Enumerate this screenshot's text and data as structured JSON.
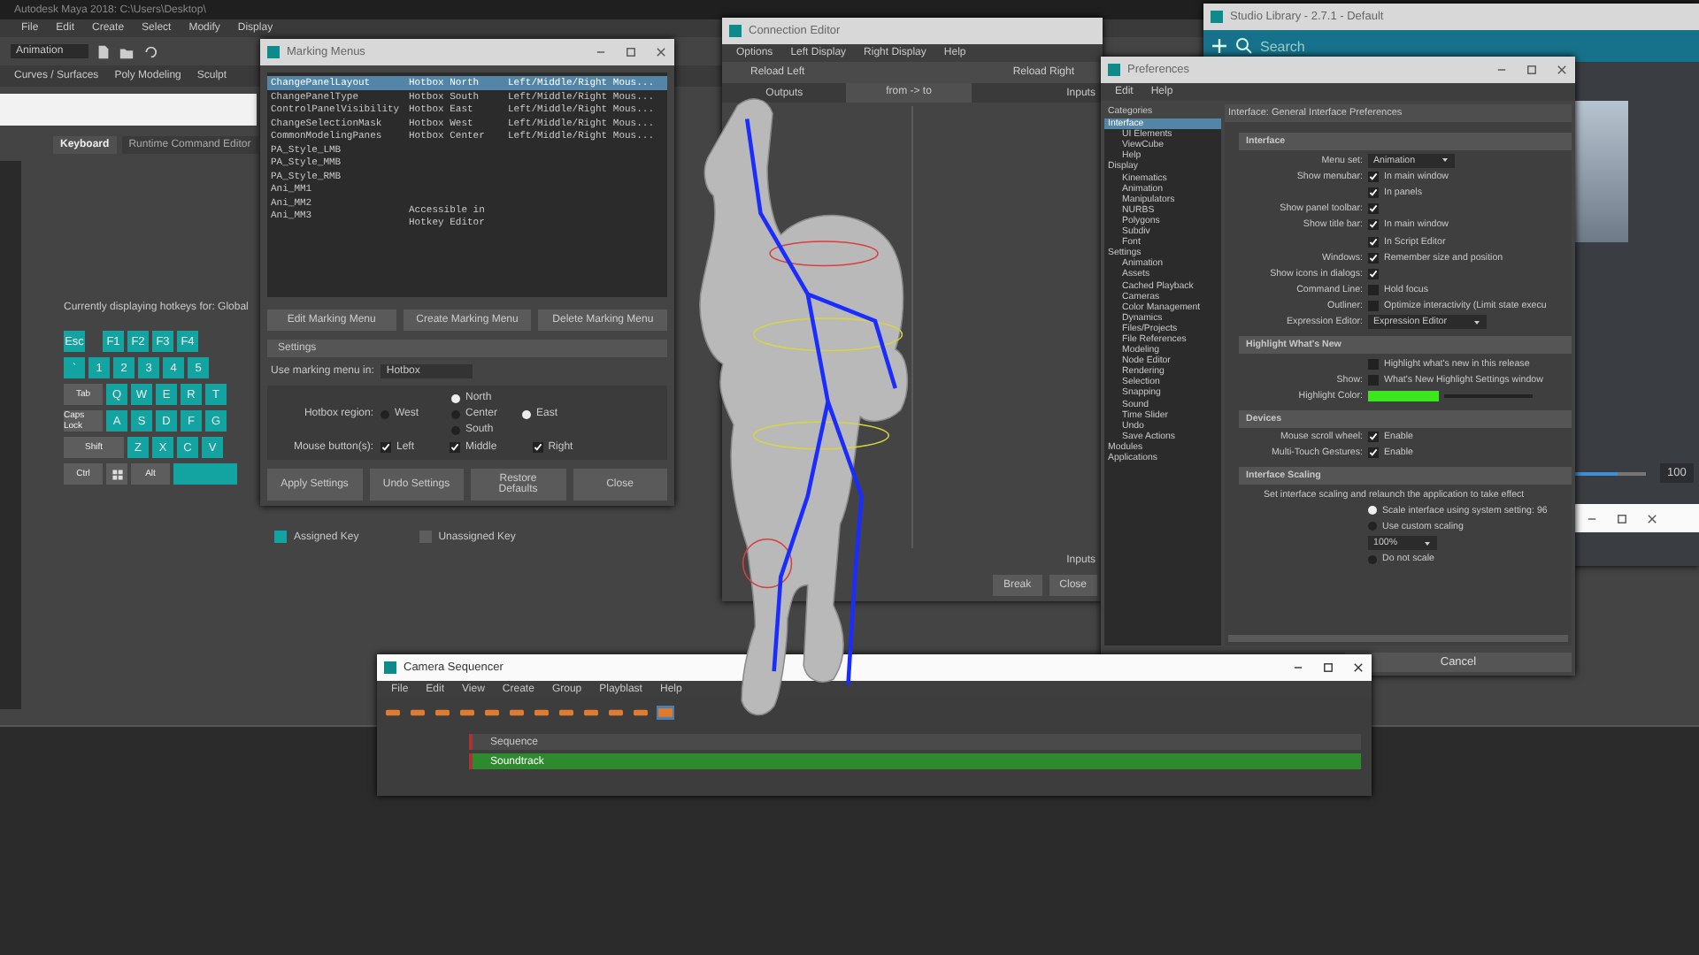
{
  "main_window": {
    "title": "Autodesk Maya 2018: C:\\Users\\Desktop\\",
    "menu": [
      "File",
      "Edit",
      "Create",
      "Select",
      "Modify",
      "Display"
    ],
    "workspace": "Animation",
    "shelf_tabs": [
      "Curves / Surfaces",
      "Poly Modeling",
      "Sculpt"
    ]
  },
  "hotkey_editor": {
    "tabs": [
      {
        "label": "Keyboard",
        "selected": true
      },
      {
        "label": "Runtime Command Editor",
        "selected": false
      }
    ],
    "caption": "Currently displaying hotkeys for: Global",
    "keyboard_rows": [
      [
        {
          "kind": "key",
          "label": "Esc",
          "assigned": true
        },
        {
          "kind": "gap"
        },
        {
          "kind": "key",
          "label": "F1",
          "assigned": true
        },
        {
          "kind": "key",
          "label": "F2",
          "assigned": true
        },
        {
          "kind": "key",
          "label": "F3",
          "assigned": true
        },
        {
          "kind": "key",
          "label": "F4",
          "assigned": true
        }
      ],
      [
        {
          "kind": "key",
          "label": "`",
          "assigned": true
        },
        {
          "kind": "key",
          "label": "1",
          "assigned": true
        },
        {
          "kind": "key",
          "label": "2",
          "assigned": true
        },
        {
          "kind": "key",
          "label": "3",
          "assigned": true
        },
        {
          "kind": "key",
          "label": "4",
          "assigned": true
        },
        {
          "kind": "key",
          "label": "5",
          "assigned": true
        }
      ],
      [
        {
          "kind": "wide",
          "label": "Tab",
          "assigned": false
        },
        {
          "kind": "key",
          "label": "Q",
          "assigned": true
        },
        {
          "kind": "key",
          "label": "W",
          "assigned": true
        },
        {
          "kind": "key",
          "label": "E",
          "assigned": true
        },
        {
          "kind": "key",
          "label": "R",
          "assigned": true
        },
        {
          "kind": "key",
          "label": "T",
          "assigned": true
        }
      ],
      [
        {
          "kind": "wide",
          "label": "Caps Lock",
          "assigned": false
        },
        {
          "kind": "key",
          "label": "A",
          "assigned": true
        },
        {
          "kind": "key",
          "label": "S",
          "assigned": true
        },
        {
          "kind": "key",
          "label": "D",
          "assigned": true
        },
        {
          "kind": "key",
          "label": "F",
          "assigned": true
        },
        {
          "kind": "key",
          "label": "G",
          "assigned": true
        }
      ],
      [
        {
          "kind": "wider",
          "label": "Shift",
          "assigned": false
        },
        {
          "kind": "key",
          "label": "Z",
          "assigned": true
        },
        {
          "kind": "key",
          "label": "X",
          "assigned": true
        },
        {
          "kind": "key",
          "label": "C",
          "assigned": true
        },
        {
          "kind": "key",
          "label": "V",
          "assigned": true
        }
      ],
      [
        {
          "kind": "wide",
          "label": "Ctrl",
          "assigned": false
        },
        {
          "kind": "windows",
          "assigned": false
        },
        {
          "kind": "wide",
          "label": "Alt",
          "assigned": false
        },
        {
          "kind": "space",
          "assigned": true
        }
      ]
    ],
    "legend": [
      {
        "label": "Assigned Key",
        "assigned": true
      },
      {
        "label": "Unassigned Key",
        "assigned": false
      }
    ]
  },
  "marking_menus": {
    "title": "Marking Menus",
    "rows": [
      {
        "name": "ChangePanelLayout",
        "location": "Hotbox North",
        "trigger": "Left/Middle/Right Mous...",
        "selected": true
      },
      {
        "name": "ChangePanelType",
        "location": "Hotbox South",
        "trigger": "Left/Middle/Right Mous...",
        "selected": false
      },
      {
        "name": "ControlPanelVisibility",
        "location": "Hotbox East",
        "trigger": "Left/Middle/Right Mous...",
        "selected": false
      },
      {
        "name": "ChangeSelectionMask",
        "location": "Hotbox West",
        "trigger": "Left/Middle/Right Mous...",
        "selected": false
      },
      {
        "name": "CommonModelingPanes",
        "location": "Hotbox Center",
        "trigger": "Left/Middle/Right Mous...",
        "selected": false
      },
      {
        "name": "PA_Style_LMB",
        "selected": false
      },
      {
        "name": "PA_Style_MMB",
        "selected": false
      },
      {
        "name": "PA_Style_RMB",
        "selected": false
      },
      {
        "name": "Ani_MM1",
        "selected": false
      },
      {
        "name": "Ani_MM2",
        "selected": false
      },
      {
        "name": "Ani_MM3",
        "location": "Accessible in Hotkey Editor",
        "selected": false
      }
    ],
    "buttons": [
      "Edit Marking Menu",
      "Create Marking Menu",
      "Delete Marking Menu"
    ],
    "settings_title": "Settings",
    "use_in": {
      "label": "Use marking menu in:",
      "value": "Hotbox"
    },
    "hotbox_region": {
      "label": "Hotbox region:",
      "options": [
        {
          "label": "North",
          "selected": true
        },
        {
          "label": "West",
          "selected": false
        },
        {
          "label": "Center",
          "selected": false
        },
        {
          "label": "East",
          "selected": true
        },
        {
          "label": "South",
          "selected": false
        }
      ]
    },
    "mouse_buttons": {
      "label": "Mouse button(s):",
      "options": [
        {
          "label": "Left",
          "checked": true
        },
        {
          "label": "Middle",
          "checked": true
        },
        {
          "label": "Right",
          "checked": true
        }
      ]
    },
    "footer_buttons": [
      "Apply Settings",
      "Undo Settings",
      "Restore Defaults",
      "Close"
    ]
  },
  "connection_editor": {
    "title": "Connection Editor",
    "menu": [
      "Options",
      "Left Display",
      "Right Display",
      "Help"
    ],
    "reload": [
      "Reload Left",
      "Reload Right"
    ],
    "columns": [
      "Outputs",
      "from -> to",
      "Inputs"
    ],
    "bottom_label": "Inputs",
    "buttons": [
      "Break",
      "Close"
    ]
  },
  "studio_library": {
    "title": "Studio Library - 2.7.1 - Default",
    "search": {
      "placeholder": "Search"
    },
    "zoom": {
      "level": 0.6
    },
    "zoom_reading": "100"
  },
  "preferences": {
    "title": "Preferences",
    "menu": [
      "Edit",
      "Help"
    ],
    "categories_title": "Categories",
    "categories": [
      {
        "label": "Interface",
        "selected": true,
        "children": [
          {
            "label": "UI Elements",
            "selected": false
          },
          {
            "label": "ViewCube",
            "selected": false
          },
          {
            "label": "Help",
            "selected": false
          }
        ]
      },
      {
        "label": "Display",
        "selected": false,
        "children": [
          {
            "label": "Kinematics",
            "selected": false
          },
          {
            "label": "Animation",
            "selected": false
          },
          {
            "label": "Manipulators",
            "selected": false
          },
          {
            "label": "NURBS",
            "selected": false
          },
          {
            "label": "Polygons",
            "selected": false
          },
          {
            "label": "Subdiv",
            "selected": false
          },
          {
            "label": "Font",
            "selected": false
          }
        ]
      },
      {
        "label": "Settings",
        "selected": false,
        "children": [
          {
            "label": "Animation",
            "selected": false
          },
          {
            "label": "Assets",
            "selected": false
          },
          {
            "label": "Cached Playback",
            "selected": false
          },
          {
            "label": "Cameras",
            "selected": false
          },
          {
            "label": "Color Management",
            "selected": false
          },
          {
            "label": "Dynamics",
            "selected": false
          },
          {
            "label": "Files/Projects",
            "selected": false
          },
          {
            "label": "File References",
            "selected": false
          },
          {
            "label": "Modeling",
            "selected": false
          },
          {
            "label": "Node Editor",
            "selected": false
          },
          {
            "label": "Rendering",
            "selected": false
          },
          {
            "label": "Selection",
            "selected": false
          },
          {
            "label": "Snapping",
            "selected": false
          },
          {
            "label": "Sound",
            "selected": false
          },
          {
            "label": "Time Slider",
            "selected": false
          },
          {
            "label": "Undo",
            "selected": false
          },
          {
            "label": "Save Actions",
            "selected": false
          }
        ]
      },
      {
        "label": "Modules",
        "selected": false
      },
      {
        "label": "Applications",
        "selected": false
      }
    ],
    "heading": "Interface: General Interface Preferences",
    "sections": [
      {
        "title": "Interface",
        "rows": [
          {
            "kind": "dropdown",
            "label": "Menu set:",
            "value": "Animation"
          },
          {
            "kind": "checkbox",
            "label": "Show menubar:",
            "checked": true,
            "text": "In main window"
          },
          {
            "kind": "checkbox",
            "checked": true,
            "text": "In panels"
          },
          {
            "kind": "checkbox",
            "label": "Show panel toolbar:",
            "checked": true
          },
          {
            "kind": "checkbox",
            "label": "Show title bar:",
            "checked": true,
            "text": "In main window"
          },
          {
            "kind": "checkbox",
            "checked": true,
            "text": "In Script Editor"
          },
          {
            "kind": "checkbox",
            "label": "Windows:",
            "checked": true,
            "text": "Remember size and position"
          },
          {
            "kind": "checkbox",
            "label": "Show icons in dialogs:",
            "checked": true
          },
          {
            "kind": "checkbox",
            "label": "Command Line:",
            "checked": false,
            "text": "Hold focus"
          },
          {
            "kind": "checkbox",
            "label": "Outliner:",
            "checked": false,
            "text": "Optimize interactivity (Limit state execu"
          },
          {
            "kind": "dropdown",
            "label": "Expression Editor:",
            "value": "Expression Editor"
          }
        ]
      },
      {
        "title": "Highlight What's New",
        "rows": [
          {
            "kind": "checkbox",
            "checked": false,
            "text": "Highlight what's new in this release"
          },
          {
            "kind": "checkbox",
            "label": "Show:",
            "checked": false,
            "text": "What's New Highlight Settings window"
          },
          {
            "kind": "color",
            "label": "Highlight Color:",
            "color": "#3ce61e"
          }
        ]
      },
      {
        "title": "Devices",
        "rows": [
          {
            "kind": "checkbox",
            "label": "Mouse scroll wheel:",
            "checked": true,
            "text": "Enable"
          },
          {
            "kind": "checkbox",
            "label": "Multi-Touch Gestures:",
            "checked": true,
            "text": "Enable"
          }
        ]
      },
      {
        "title": "Interface Scaling",
        "rows": [
          {
            "kind": "note",
            "text": "Set interface scaling and relaunch the application to take effect"
          },
          {
            "kind": "radio",
            "selected": true,
            "text": "Scale interface using system setting: 96"
          },
          {
            "kind": "radio",
            "selected": false,
            "text": "Use custom scaling"
          },
          {
            "kind": "dropdown",
            "value": "100%"
          },
          {
            "kind": "radio",
            "selected": false,
            "text": "Do not scale"
          }
        ]
      }
    ],
    "cancel": "Cancel"
  },
  "camera_sequencer": {
    "title": "Camera Sequencer",
    "menu": [
      "File",
      "Edit",
      "View",
      "Create",
      "Group",
      "Playblast",
      "Help"
    ],
    "tracks": [
      {
        "label": "Sequence",
        "kind": "sequence"
      },
      {
        "label": "Soundtrack",
        "kind": "soundtrack"
      }
    ]
  }
}
